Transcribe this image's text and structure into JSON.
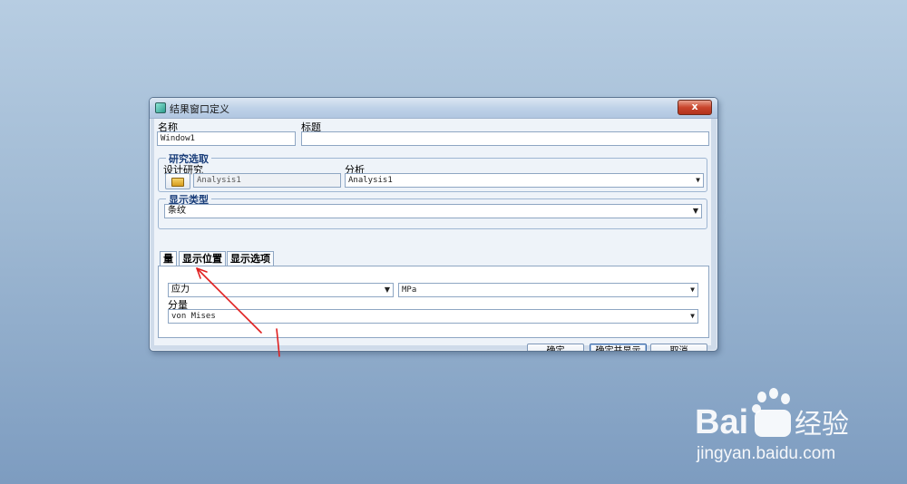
{
  "dialog": {
    "title": "结果窗口定义",
    "close_label": "x",
    "name_label": "名称",
    "name_value": "Window1",
    "heading_label": "标题",
    "heading_value": "",
    "study_group": {
      "legend": "研究选取",
      "design_study_label": "设计研究",
      "design_study_value": "Analysis1",
      "analysis_label": "分析",
      "analysis_value": "Analysis1"
    },
    "display_type_group": {
      "legend": "显示类型",
      "value": "条纹"
    },
    "tabs": [
      {
        "label": "量",
        "active": true
      },
      {
        "label": "显示位置",
        "active": false
      },
      {
        "label": "显示选项",
        "active": false
      }
    ],
    "quantity": {
      "value": "应力",
      "unit": "MPa",
      "component_label": "分量",
      "component_value": "von Mises"
    },
    "buttons": {
      "ok": "确定",
      "ok_show": "确定并显示",
      "cancel": "取消"
    }
  },
  "annotation": {
    "color": "#e02020"
  },
  "watermark": {
    "brand_left": "Bai",
    "brand_right": "经验",
    "url": "jingyan.baidu.com"
  },
  "colors": {
    "accent_blue": "#1a3e7a",
    "close_red": "#c9452c"
  }
}
